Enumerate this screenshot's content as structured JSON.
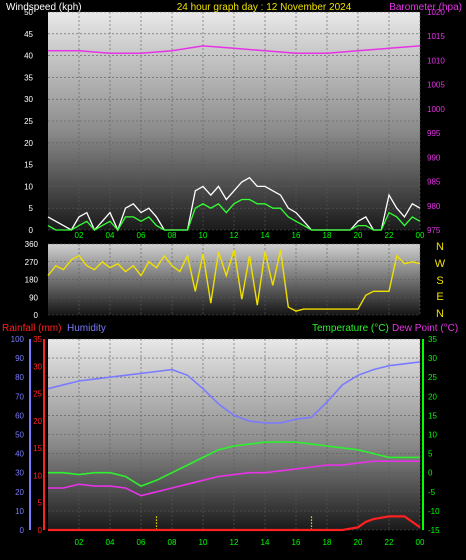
{
  "header": {
    "left": "Windspeed (kph)",
    "center": "24 hour graph day : 12 November 2024",
    "right": "Barometer (hpa)"
  },
  "colors": {
    "wind": "#ffffff",
    "gust_fill": "#2ca02c",
    "gust_line": "#33ff33",
    "barometer": "#e633e6",
    "direction": "#f0e000",
    "rain": "#ff2020",
    "humidity": "#7b7bff",
    "temperature": "#2ef02e",
    "dewpoint": "#e633e6",
    "tick_green": "#00ff00",
    "tick_axis_wind": "#ffffff",
    "tick_axis_pres": "#e633e6",
    "tick_axis_rain": "#ff2020",
    "tick_axis_hum": "#7b7bff",
    "direction_labels": "#f0e000"
  },
  "chart_data": [
    {
      "type": "line",
      "title": "24 hour graph day : 12 November 2024",
      "xlabel": "",
      "x_ticks": [
        "02",
        "04",
        "06",
        "08",
        "10",
        "12",
        "14",
        "16",
        "18",
        "20",
        "22",
        "00"
      ],
      "left_axis": {
        "label": "Windspeed (kph)",
        "ylim": [
          0,
          50
        ],
        "ticks": [
          0,
          5,
          10,
          15,
          20,
          25,
          30,
          35,
          40,
          45,
          50
        ]
      },
      "right_axis": {
        "label": "Barometer (hpa)",
        "ylim": [
          975,
          1020
        ],
        "ticks": [
          975,
          980,
          985,
          990,
          995,
          1000,
          1005,
          1010,
          1015,
          1020
        ]
      },
      "series": [
        {
          "name": "Barometer (hpa)",
          "axis": "right",
          "x": [
            0,
            2,
            4,
            6,
            8,
            10,
            12,
            14,
            16,
            18,
            20,
            22,
            24
          ],
          "values": [
            1012,
            1012,
            1011.5,
            1011.5,
            1012,
            1013,
            1012.5,
            1012,
            1011.5,
            1011.5,
            1012,
            1012.5,
            1013
          ]
        },
        {
          "name": "Windspeed (kph)",
          "axis": "left",
          "x": [
            0,
            0.5,
            1,
            1.5,
            2,
            2.5,
            3,
            3.5,
            4,
            4.5,
            5,
            5.5,
            6,
            6.5,
            7,
            7.5,
            8,
            8.5,
            9,
            9.5,
            10,
            10.5,
            11,
            11.5,
            12,
            12.5,
            13,
            13.5,
            14,
            14.5,
            15,
            15.5,
            16,
            16.5,
            17,
            17.5,
            18,
            18.5,
            19,
            19.5,
            20,
            20.5,
            21,
            21.5,
            22,
            22.5,
            23,
            23.5,
            24
          ],
          "values": [
            3,
            2,
            1,
            0,
            3,
            4,
            0,
            2,
            4,
            0,
            5,
            6,
            4,
            5,
            3,
            0,
            0,
            0,
            0,
            9,
            10,
            8,
            10,
            7,
            9,
            11,
            12,
            10,
            10,
            9,
            8,
            5,
            4,
            2,
            0,
            0,
            0,
            0,
            0,
            0,
            2,
            3,
            0,
            0,
            8,
            5,
            3,
            6,
            5
          ]
        },
        {
          "name": "Gust",
          "axis": "left",
          "x": [
            0,
            0.5,
            1,
            1.5,
            2,
            2.5,
            3,
            3.5,
            4,
            4.5,
            5,
            5.5,
            6,
            6.5,
            7,
            7.5,
            8,
            8.5,
            9,
            9.5,
            10,
            10.5,
            11,
            11.5,
            12,
            12.5,
            13,
            13.5,
            14,
            14.5,
            15,
            15.5,
            16,
            16.5,
            17,
            17.5,
            18,
            18.5,
            19,
            19.5,
            20,
            20.5,
            21,
            21.5,
            22,
            22.5,
            23,
            23.5,
            24
          ],
          "values": [
            1,
            0,
            0,
            0,
            1,
            2,
            0,
            1,
            2,
            0,
            3,
            3,
            2,
            3,
            1,
            0,
            0,
            0,
            0,
            5,
            6,
            5,
            6,
            4,
            6,
            7,
            7,
            6,
            6,
            5,
            5,
            3,
            2,
            1,
            0,
            0,
            0,
            0,
            0,
            0,
            1,
            1,
            0,
            0,
            4,
            3,
            1,
            3,
            2
          ]
        }
      ]
    },
    {
      "type": "line",
      "title": "",
      "ylim": [
        0,
        360
      ],
      "left_ticks": [
        0,
        90,
        180,
        270,
        360
      ],
      "right_labels": [
        "N",
        "W",
        "S",
        "E",
        "N"
      ],
      "series": [
        {
          "name": "Wind direction",
          "x": [
            0,
            0.5,
            1,
            1.5,
            2,
            2.5,
            3,
            3.5,
            4,
            4.5,
            5,
            5.5,
            6,
            6.5,
            7,
            7.5,
            8,
            8.5,
            9,
            9.5,
            10,
            10.5,
            11,
            11.5,
            12,
            12.5,
            13,
            13.5,
            14,
            14.5,
            15,
            15.5,
            16,
            16.5,
            17,
            17.5,
            18,
            18.5,
            19,
            19.5,
            20,
            20.5,
            21,
            21.5,
            22,
            22.5,
            23,
            23.5,
            24
          ],
          "values": [
            200,
            250,
            230,
            280,
            300,
            250,
            230,
            270,
            240,
            260,
            220,
            250,
            200,
            270,
            240,
            300,
            250,
            220,
            300,
            120,
            310,
            60,
            320,
            200,
            330,
            80,
            300,
            50,
            320,
            150,
            330,
            40,
            20,
            30,
            30,
            30,
            30,
            30,
            30,
            30,
            30,
            100,
            120,
            120,
            120,
            300,
            260,
            270,
            260
          ]
        }
      ]
    },
    {
      "type": "line",
      "title": "",
      "x_ticks": [
        "02",
        "04",
        "06",
        "08",
        "10",
        "12",
        "14",
        "16",
        "18",
        "20",
        "22",
        "00"
      ],
      "axes": {
        "humidity": {
          "label": "Humidity",
          "ylim": [
            0,
            100
          ],
          "ticks": [
            0,
            10,
            20,
            30,
            40,
            50,
            60,
            70,
            80,
            90,
            100
          ]
        },
        "rainfall": {
          "label": "Rainfall (mm)",
          "ylim": [
            0,
            35
          ],
          "ticks": [
            0,
            5,
            10,
            15,
            20,
            25,
            30,
            35
          ]
        },
        "temperature": {
          "label": "Temperature (°C)",
          "ylim": [
            -15,
            35
          ],
          "ticks": [
            -15,
            -10,
            -5,
            0,
            5,
            10,
            15,
            20,
            25,
            30,
            35
          ]
        }
      },
      "right_label_2": "Dew Point (°C)",
      "series": [
        {
          "name": "Humidity",
          "axis": "humidity",
          "x": [
            0,
            1,
            2,
            3,
            4,
            5,
            6,
            7,
            8,
            9,
            10,
            11,
            12,
            13,
            14,
            15,
            16,
            17,
            18,
            19,
            20,
            21,
            22,
            23,
            24
          ],
          "values": [
            74,
            76,
            78,
            79,
            80,
            81,
            82,
            83,
            84,
            81,
            74,
            66,
            60,
            57,
            56,
            56,
            58,
            59,
            67,
            76,
            81,
            84,
            86,
            87,
            88
          ]
        },
        {
          "name": "Temperature (°C)",
          "axis": "temperature",
          "x": [
            0,
            1,
            2,
            3,
            4,
            5,
            6,
            7,
            8,
            9,
            10,
            11,
            12,
            13,
            14,
            15,
            16,
            17,
            18,
            19,
            20,
            21,
            22,
            23,
            24
          ],
          "values": [
            0,
            0,
            -0.5,
            0,
            0,
            -1,
            -3.5,
            -2,
            0,
            2,
            4,
            6,
            7,
            7.5,
            8,
            8,
            8,
            7.5,
            7,
            6.5,
            6,
            5,
            4,
            4,
            4
          ]
        },
        {
          "name": "Dew Point (°C)",
          "axis": "temperature",
          "x": [
            0,
            1,
            2,
            3,
            4,
            5,
            6,
            7,
            8,
            9,
            10,
            11,
            12,
            13,
            14,
            15,
            16,
            17,
            18,
            19,
            20,
            21,
            22,
            23,
            24
          ],
          "values": [
            -4,
            -4,
            -3,
            -3.5,
            -3.5,
            -4,
            -6,
            -5,
            -4,
            -3,
            -2,
            -1,
            -0.5,
            0,
            0,
            0.5,
            1,
            1.5,
            2,
            2,
            2.5,
            3,
            3,
            3,
            3
          ]
        },
        {
          "name": "Rainfall (mm)",
          "axis": "rainfall",
          "x": [
            0,
            2,
            4,
            6,
            8,
            10,
            12,
            14,
            16,
            18,
            19,
            20,
            20.5,
            21,
            22,
            23,
            24
          ],
          "values": [
            0,
            0,
            0,
            0,
            0,
            0,
            0,
            0,
            0,
            0,
            0,
            0.5,
            1.5,
            2,
            2.5,
            2.5,
            0.5
          ]
        }
      ],
      "markers_x": [
        7,
        17
      ]
    }
  ],
  "panel2_labels": {
    "n_top": "N",
    "w": "W",
    "s": "S",
    "e": "E",
    "n_bottom": "N"
  },
  "panel3_header": {
    "rain": "Rainfall (mm)",
    "hum": "Humidity",
    "temp": "Temperature (°C)",
    "dew": "Dew Point (°C)"
  }
}
